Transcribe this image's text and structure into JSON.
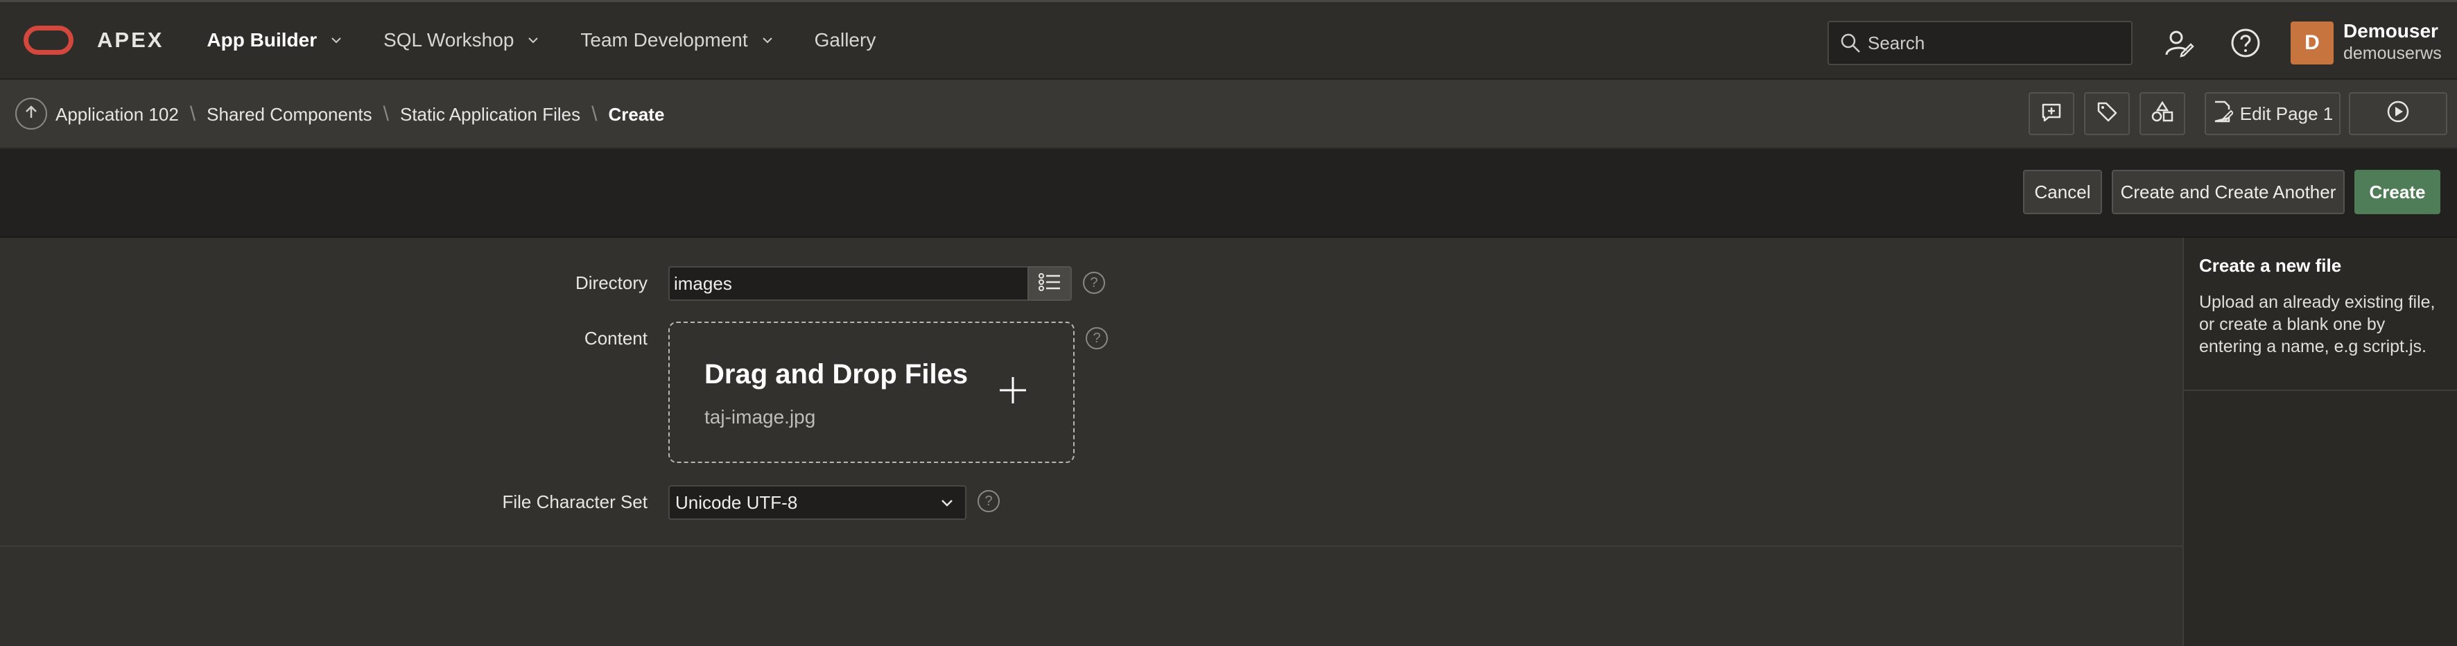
{
  "brand": {
    "name": "APEX"
  },
  "nav": {
    "items": [
      {
        "label": "App Builder",
        "has_menu": true,
        "active": true
      },
      {
        "label": "SQL Workshop",
        "has_menu": true,
        "active": false
      },
      {
        "label": "Team Development",
        "has_menu": true,
        "active": false
      },
      {
        "label": "Gallery",
        "has_menu": false,
        "active": false
      }
    ]
  },
  "search": {
    "placeholder": "Search"
  },
  "user": {
    "initial": "D",
    "name": "Demouser",
    "workspace": "demouserws"
  },
  "breadcrumb": {
    "items": [
      "Application 102",
      "Shared Components",
      "Static Application Files"
    ],
    "current": "Create"
  },
  "toolbar": {
    "edit_page_label": "Edit Page 1"
  },
  "actions": {
    "cancel": "Cancel",
    "create_another": "Create and Create Another",
    "create": "Create"
  },
  "form": {
    "directory": {
      "label": "Directory",
      "value": "images"
    },
    "content": {
      "label": "Content",
      "title": "Drag and Drop Files",
      "file": "taj-image.jpg"
    },
    "charset": {
      "label": "File Character Set",
      "value": "Unicode UTF-8"
    },
    "help_glyph": "?"
  },
  "help_panel": {
    "title": "Create a new file",
    "text": "Upload an already existing file, or create a blank one by entering a name, e.g script.js."
  },
  "colors": {
    "accent_red": "#d4473c",
    "primary_green": "#4f7d57",
    "avatar": "#c8743f"
  },
  "icons": [
    "search-icon",
    "user-settings-icon",
    "help-icon",
    "up-arrow-icon",
    "add-comment-icon",
    "tag-icon",
    "shapes-icon",
    "edit-page-icon",
    "play-icon",
    "list-icon",
    "plus-icon",
    "chevron-down-icon"
  ]
}
